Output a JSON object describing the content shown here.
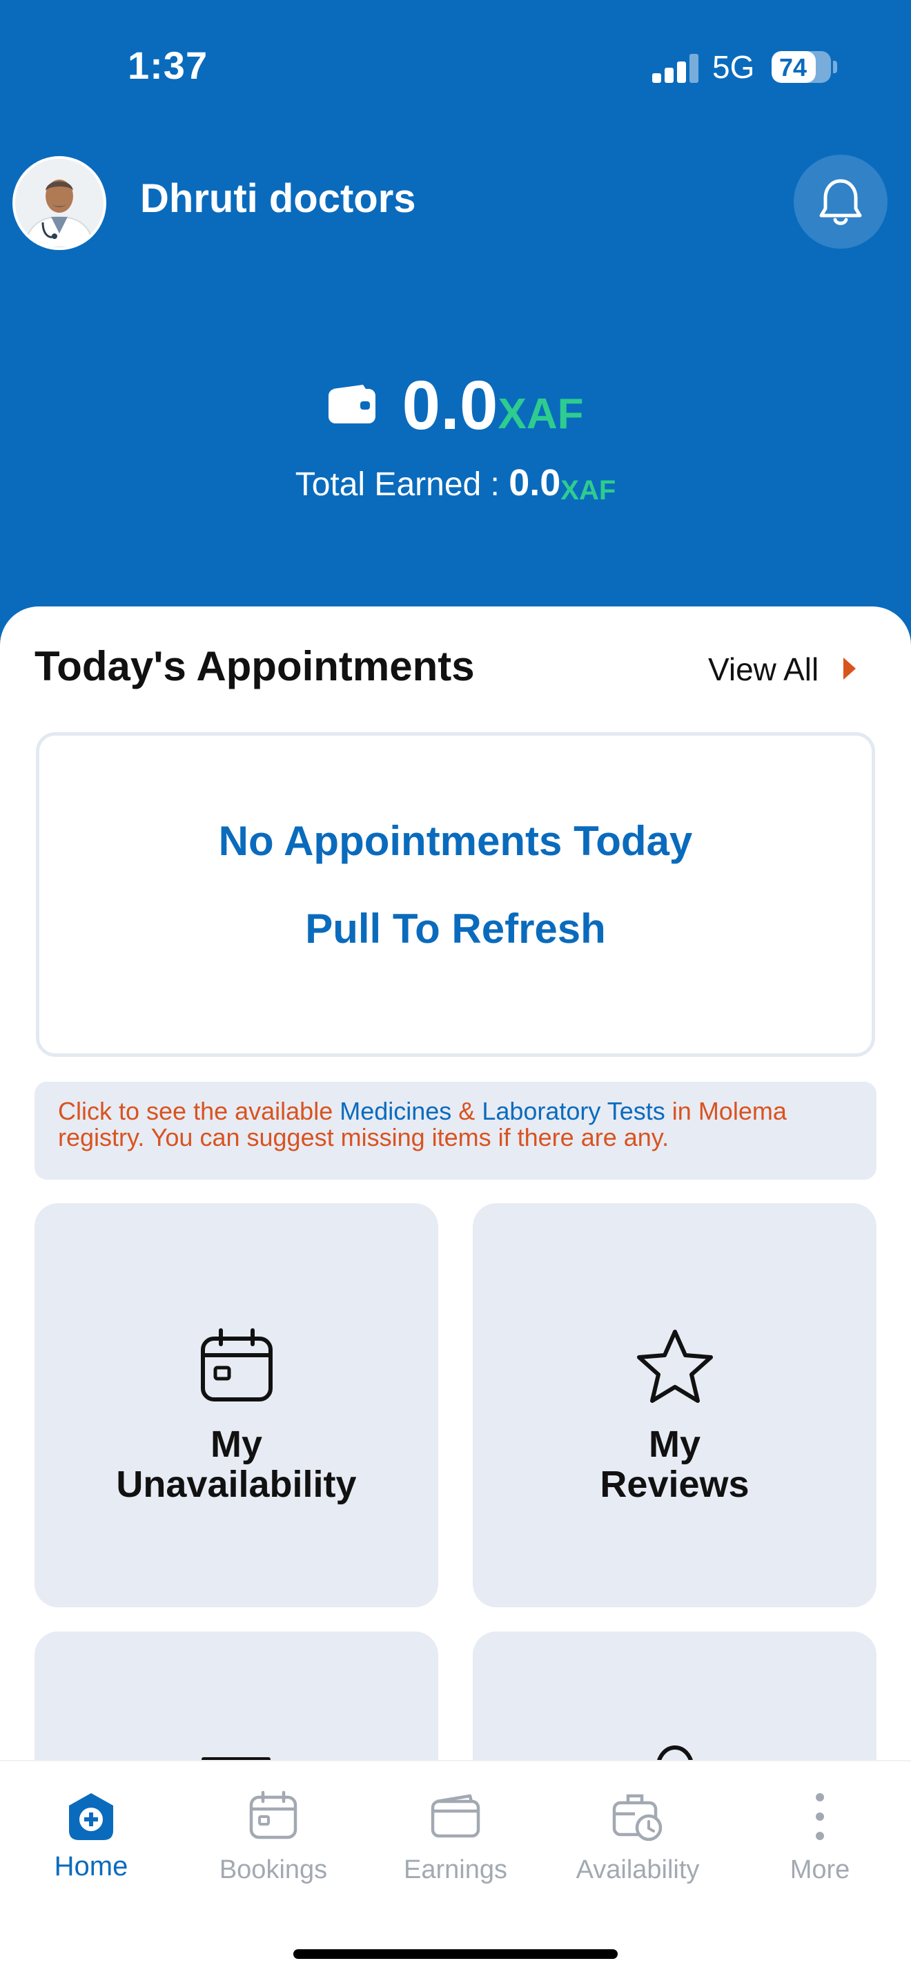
{
  "status_bar": {
    "time": "1:37",
    "network": "5G",
    "battery": "74",
    "battery_level_percent": 74,
    "signal_bars_filled": 3
  },
  "header": {
    "doctor_name": "Dhruti doctors",
    "avatar_icon": "doctor-avatar",
    "notification_icon": "bell-icon"
  },
  "wallet": {
    "icon": "wallet-icon",
    "balance": "0.0",
    "currency": "XAF",
    "total_earned_label": "Total Earned : ",
    "total_earned_value": "0.0",
    "total_earned_currency": "XAF"
  },
  "appointments": {
    "title": "Today's Appointments",
    "view_all": "View All",
    "empty_line1": "No Appointments Today",
    "empty_line2": "Pull To Refresh"
  },
  "info_banner": {
    "text_before": "Click to see the available ",
    "link_medicines": "Medicines",
    "ampersand": " & ",
    "link_lab": "Laboratory Tests",
    "text_after": " in Molema registry. You can suggest missing items if there are any."
  },
  "tiles": [
    {
      "line1": "My",
      "line2": "Unavailability",
      "icon": "calendar-icon"
    },
    {
      "line1": "My",
      "line2": "Reviews",
      "icon": "star-icon"
    }
  ],
  "tab_bar": [
    {
      "label": "Home",
      "icon": "home-plus-icon",
      "active": true
    },
    {
      "label": "Bookings",
      "icon": "calendar-icon",
      "active": false
    },
    {
      "label": "Earnings",
      "icon": "wallet-icon",
      "active": false
    },
    {
      "label": "Availability",
      "icon": "briefcase-clock-icon",
      "active": false
    },
    {
      "label": "More",
      "icon": "more-vertical-icon",
      "active": false
    }
  ],
  "colors": {
    "primary_blue": "#0a6bbd",
    "currency_green": "#2ecc8f",
    "accent_orange": "#d9531e",
    "tile_bg": "#e7ebf4",
    "inactive_tab": "#a3a9b2"
  }
}
